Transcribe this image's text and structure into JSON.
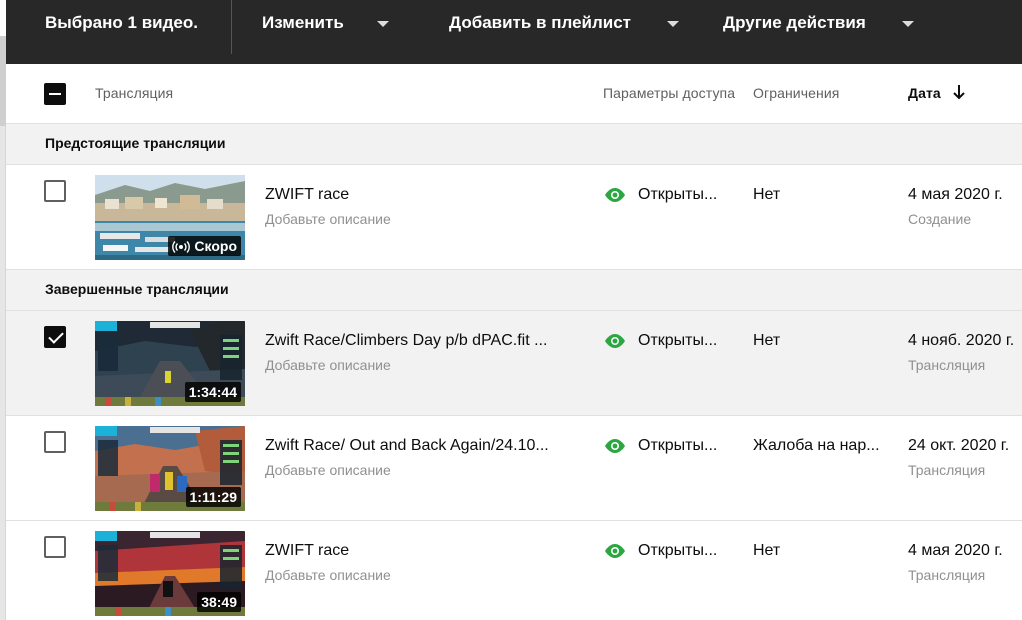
{
  "action_bar": {
    "selected_label": "Выбрано 1 видео.",
    "edit_label": "Изменить",
    "add_to_playlist_label": "Добавить в плейлист",
    "more_actions_label": "Другие действия"
  },
  "table_header": {
    "video_col": "Трансляция",
    "visibility_col": "Параметры доступа",
    "restrictions_col": "Ограничения",
    "date_col": "Дата",
    "sort_direction": "descending"
  },
  "sections": [
    {
      "label": "Предстоящие трансляции",
      "rows": [
        {
          "checked": false,
          "title": "ZWIFT race",
          "description": "Добавьте описание",
          "badge": "Скоро",
          "badge_icon": "live-broadcast-icon",
          "visibility_icon": "eye-icon",
          "visibility": "Открыты...",
          "restrictions": "Нет",
          "date": "4 мая 2020 г.",
          "date_type": "Создание"
        }
      ]
    },
    {
      "label": "Завершенные трансляции",
      "rows": [
        {
          "checked": true,
          "title": "Zwift Race/Climbers Day p/b dPAC.fit ...",
          "description": "Добавьте описание",
          "badge": "1:34:44",
          "visibility_icon": "eye-icon",
          "visibility": "Открыты...",
          "restrictions": "Нет",
          "date": "4 нояб. 2020 г.",
          "date_type": "Трансляция"
        },
        {
          "checked": false,
          "title": "Zwift Race/ Out and Back Again/24.10...",
          "description": "Добавьте описание",
          "badge": "1:11:29",
          "visibility_icon": "eye-icon",
          "visibility": "Открыты...",
          "restrictions": "Жалоба на нар...",
          "date": "24 окт. 2020 г.",
          "date_type": "Трансляция"
        },
        {
          "checked": false,
          "title": "ZWIFT race",
          "description": "Добавьте описание",
          "badge": "38:49",
          "visibility_icon": "eye-icon",
          "visibility": "Открыты...",
          "restrictions": "Нет",
          "date": "4 мая 2020 г.",
          "date_type": "Трансляция"
        }
      ]
    }
  ],
  "colors": {
    "action_bar_bg": "#282828",
    "visibility_green": "#2ba640",
    "section_bg": "#f2f2f2",
    "secondary_text": "#909090"
  }
}
